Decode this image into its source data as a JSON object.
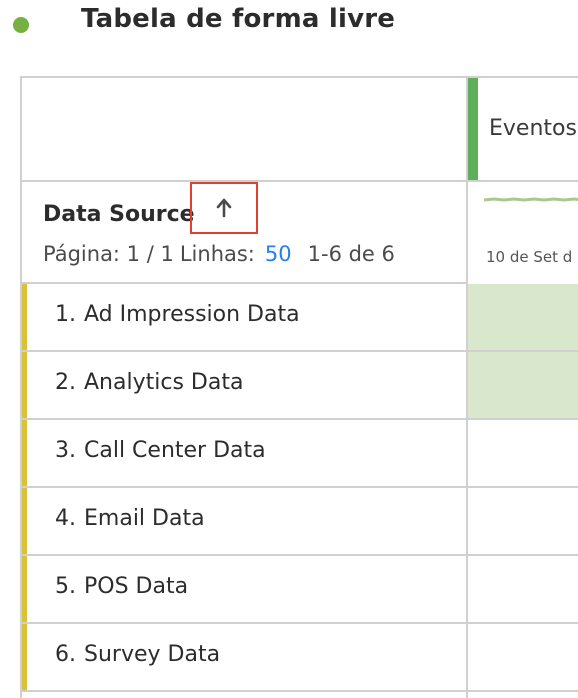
{
  "panel": {
    "title": "Tabela de forma livre",
    "dot_color": "#76b043"
  },
  "table": {
    "metric_header": "Eventos",
    "metric_color": "#5faf5a",
    "dimension_header": "Data Source",
    "sort_icon": "arrow-up-icon",
    "pagination": {
      "page_label": "Página: 1 / 1",
      "rows_label": "Linhas:",
      "rows_value": "50",
      "range": "1-6 de 6"
    },
    "date_label": "10 de Set d",
    "rows": [
      {
        "num": "1.",
        "label": "Ad Impression Data",
        "highlighted": true
      },
      {
        "num": "2.",
        "label": "Analytics Data",
        "highlighted": true
      },
      {
        "num": "3.",
        "label": "Call Center Data",
        "highlighted": false
      },
      {
        "num": "4.",
        "label": "Email Data",
        "highlighted": false
      },
      {
        "num": "5.",
        "label": "POS Data",
        "highlighted": false
      },
      {
        "num": "6.",
        "label": "Survey Data",
        "highlighted": false
      }
    ],
    "row_accent_color": "#d9c23a",
    "cell_fill_color": "#d9e8cc"
  }
}
